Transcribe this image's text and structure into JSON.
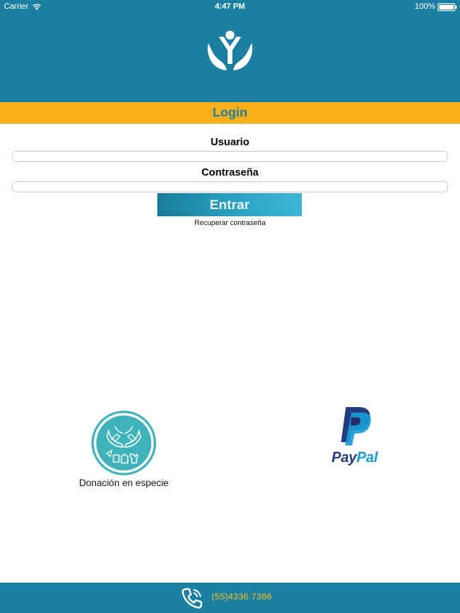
{
  "status_bar": {
    "carrier": "Carrier",
    "time": "4:47 PM",
    "battery": "100%",
    "battery_level": 1.0
  },
  "header": {
    "logo_icon": "hands-person-logo-icon"
  },
  "login": {
    "title": "Login",
    "username_label": "Usuario",
    "username_value": "",
    "password_label": "Contraseña",
    "password_value": "",
    "submit_label": "Entrar",
    "recover_label": "Recuperar contraseña"
  },
  "donation": {
    "label": "Donación en especie",
    "icon": "hands-giving-items-icon"
  },
  "paypal": {
    "brand_pay": "Pay",
    "brand_pal": "Pal",
    "icon": "paypal-logo-icon"
  },
  "footer": {
    "phone": "(55)4336 7386",
    "icon": "phone-icon"
  },
  "colors": {
    "primary": "#1a7fa0",
    "accent": "#f9ae1b",
    "phone_text": "#f9c21b",
    "paypal_dark": "#253b80",
    "paypal_light": "#179bd7",
    "donation_teal": "#3fb3b9"
  }
}
